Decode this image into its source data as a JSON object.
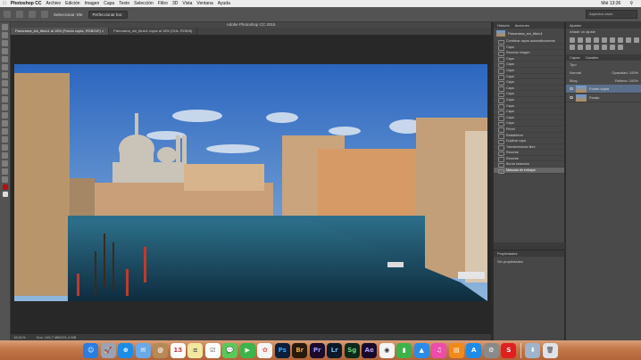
{
  "menubar": {
    "apple": "",
    "items": [
      "Photoshop CC",
      "Archivo",
      "Edición",
      "Imagen",
      "Capa",
      "Texto",
      "Selección",
      "Filtro",
      "3D",
      "Vista",
      "Ventana",
      "Ayuda"
    ],
    "clock": "Mié 13:36"
  },
  "options": {
    "select_label": "Seleccionar: Ele",
    "refine": "Perfeccionar bor.",
    "search": "Aspectos esen."
  },
  "app_title": "Adobe Photoshop CC 2015",
  "document_title": "Panorama_sin_titulo1 al 18% (Fondo copia, RGB/16*) *",
  "tabs": [
    {
      "label": "Panorama_sin_titulo1 al 18% (Fondo copia, RGB/16*) ×"
    },
    {
      "label": "Panorama_sin_titulo1 copia al 18% (Gris, RGB/8)"
    }
  ],
  "status": {
    "zoom": "18,61%",
    "doc": "Doc: 145,7 MB/291,4 MB"
  },
  "history": {
    "tabs": [
      "Historia",
      "Acciones"
    ],
    "snapshot": "Panorama_sin_titulo1",
    "items": [
      "Combinar capas automáticamente",
      "Capa",
      "Recortar imagen",
      "Capa",
      "Capa",
      "Capa",
      "Capa",
      "Capa",
      "Capa",
      "Capa",
      "Capa",
      "Capa",
      "Capa",
      "Capa",
      "Capa",
      "Pincel",
      "Restablecer",
      "Duplicar capa",
      "Transformación libre",
      "Recortar",
      "Recortar",
      "Borrar selección",
      "Máscara de enfoque"
    ]
  },
  "properties": {
    "title": "Propiedades",
    "empty": "Sin propiedades"
  },
  "adjustments": {
    "tabs": [
      "Ajustes"
    ],
    "subtitle": "Añadir un ajuste"
  },
  "layers": {
    "tabs": [
      "Capas",
      "Canales"
    ],
    "kind": "Tipo",
    "blend": "Normal",
    "opacity": "Opacidad: 100%",
    "lock": "Bloq.:",
    "fill": "Relleno: 100%",
    "items": [
      {
        "name": "Fondo copia",
        "selected": true
      },
      {
        "name": "Fondo",
        "selected": false
      }
    ]
  },
  "dock": [
    "Finder",
    "Launchpad",
    "Safari",
    "Mail",
    "Contacts",
    "Calendar",
    "Notes",
    "Reminders",
    "Messages",
    "FaceTime",
    "Photos",
    "Ps",
    "Br",
    "Pr",
    "Lr",
    "Sg",
    "Ae",
    "Preview",
    "Numbers",
    "Keynote",
    "iTunes",
    "iBooks",
    "App Store",
    "System Preferences",
    "S",
    "Downloads",
    "Trash"
  ]
}
